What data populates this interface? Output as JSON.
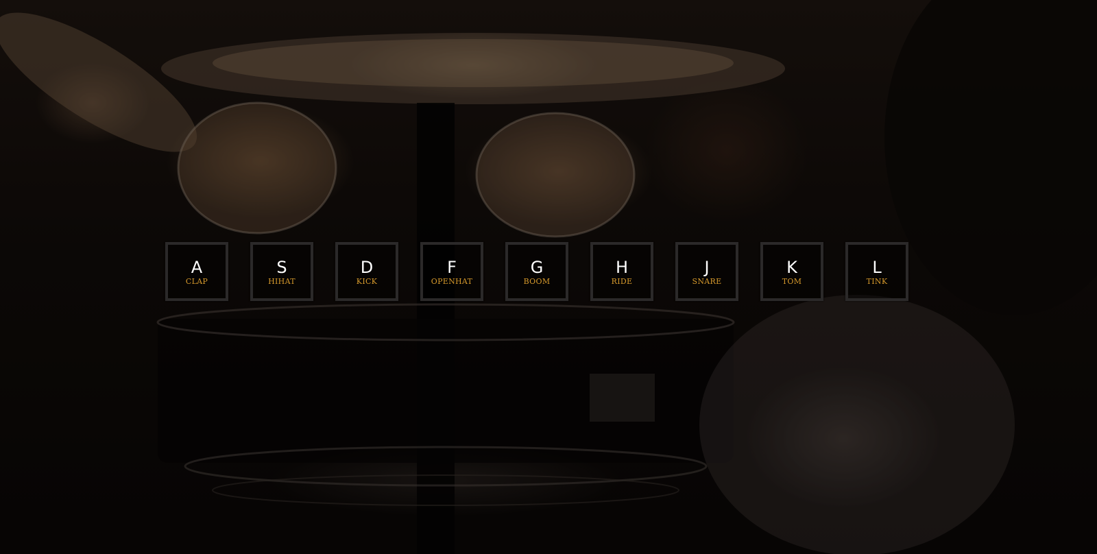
{
  "keys": [
    {
      "letter": "A",
      "sound": "CLAP"
    },
    {
      "letter": "S",
      "sound": "HIHAT"
    },
    {
      "letter": "D",
      "sound": "KICK"
    },
    {
      "letter": "F",
      "sound": "OPENHAT"
    },
    {
      "letter": "G",
      "sound": "BOOM"
    },
    {
      "letter": "H",
      "sound": "RIDE"
    },
    {
      "letter": "J",
      "sound": "SNARE"
    },
    {
      "letter": "K",
      "sound": "TOM"
    },
    {
      "letter": "L",
      "sound": "TINK"
    }
  ]
}
